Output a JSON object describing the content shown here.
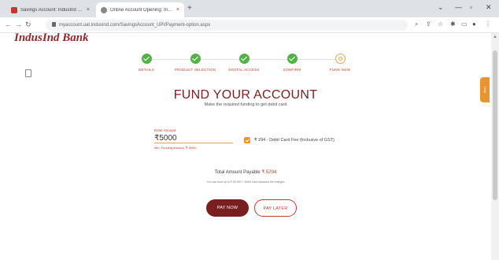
{
  "browser": {
    "tabs": [
      {
        "title": "Savings Account: IndusInd Bank"
      },
      {
        "title": "Online Account Opening: IndusInd"
      }
    ],
    "url": "myaccount.uat.indusind.com/SavingsAccount_UPI/Payment-option.aspx"
  },
  "brand": {
    "name": "IndusInd Bank",
    "color": "#8a2a2a"
  },
  "steps": [
    {
      "label": "DETAILS",
      "status": "done"
    },
    {
      "label": "PRODUCT SELECTION",
      "status": "done"
    },
    {
      "label": "DIGITAL ACCESS",
      "status": "done"
    },
    {
      "label": "CONFIRM",
      "status": "done"
    },
    {
      "label": "FUND NOW",
      "status": "current"
    }
  ],
  "help_tab": {
    "label": "Help"
  },
  "fund": {
    "title": "FUND YOUR ACCOUNT",
    "subtitle": "Make the required funding to get debit card",
    "amount_label": "Enter Amount",
    "amount_value": "₹5000",
    "amount_hint": "Min. Funding amount: ₹ 5000/-",
    "fee_text": "₹ 294 - Debit Card Fee (Inclusive of GST)",
    "total_label": "Total Amount Payable",
    "total_value": "₹ 5294",
    "note": "You can fund up to ₹ 50,000 + Debit Card issuance fee charges",
    "pay_now": "PAY NOW",
    "pay_later": "PAY LATER"
  },
  "colors": {
    "accent": "#7a1f1f",
    "success": "#56b04a",
    "warning": "#e9942f"
  }
}
